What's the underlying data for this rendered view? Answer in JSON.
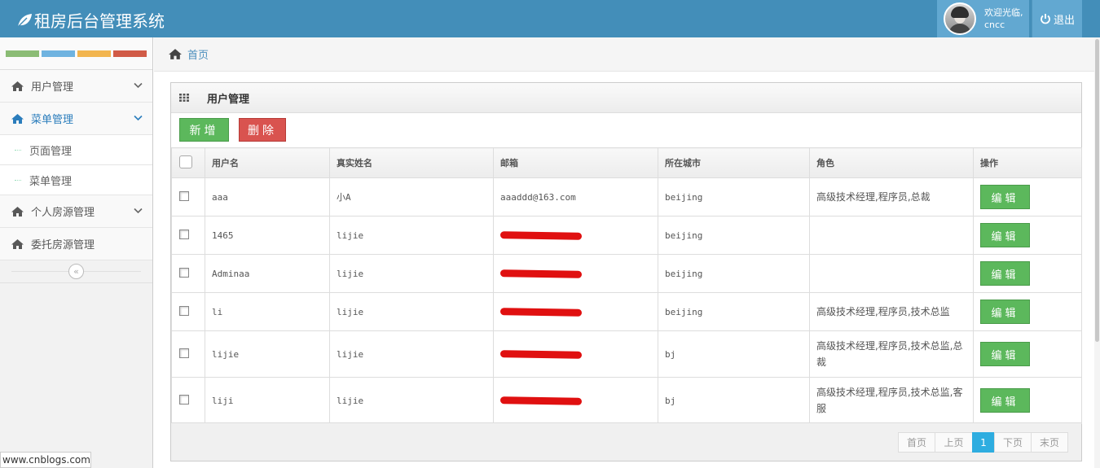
{
  "header": {
    "app_title": "租房后台管理系统",
    "welcome": "欢迎光临,",
    "username": "cncc",
    "logout_label": "退出",
    "bg_color": "#438eb9"
  },
  "sidebar": {
    "shortcut_colors": [
      "#8bbc75",
      "#6fb3e0",
      "#f2b54f",
      "#d15b47"
    ],
    "menu": [
      {
        "label": "用户管理",
        "icon": "home-icon"
      },
      {
        "label": "菜单管理",
        "icon": "home-icon",
        "active": true
      },
      {
        "label": "页面管理"
      },
      {
        "label": "菜单管理"
      },
      {
        "label": "个人房源管理",
        "icon": "home-icon"
      },
      {
        "label": "委托房源管理",
        "icon": "home-icon"
      }
    ]
  },
  "breadcrumb": {
    "home_label": "首页"
  },
  "panel": {
    "title": "用户管理",
    "add_label": "新增",
    "delete_label": "删除"
  },
  "table": {
    "headers": [
      "用户名",
      "真实姓名",
      "邮箱",
      "所在城市",
      "角色",
      "操作"
    ],
    "edit_label": "编辑",
    "rows": [
      {
        "username": "aaa",
        "realname": "小A",
        "email": "aaaddd@163.com",
        "redacted": false,
        "city": "beijing",
        "role": "高级技术经理,程序员,总裁"
      },
      {
        "username": "1465",
        "realname": "lijie",
        "email": "",
        "redacted": true,
        "city": "beijing",
        "role": ""
      },
      {
        "username": "Adminaa",
        "realname": "lijie",
        "email": "",
        "redacted": true,
        "city": "beijing",
        "role": ""
      },
      {
        "username": "li",
        "realname": "lijie",
        "email": "",
        "redacted": true,
        "city": "beijing",
        "role": "高级技术经理,程序员,技术总监"
      },
      {
        "username": "lijie",
        "realname": "lijie",
        "email": "",
        "redacted": true,
        "city": "bj",
        "role": "高级技术经理,程序员,技术总监,总裁"
      },
      {
        "username": "liji",
        "realname": "lijie",
        "email": "",
        "redacted": true,
        "city": "bj",
        "role": "高级技术经理,程序员,技术总监,客服"
      }
    ]
  },
  "pager": {
    "first": "首页",
    "prev": "上页",
    "current": "1",
    "next": "下页",
    "last": "末页"
  },
  "watermark": "www.cnblogs.com"
}
